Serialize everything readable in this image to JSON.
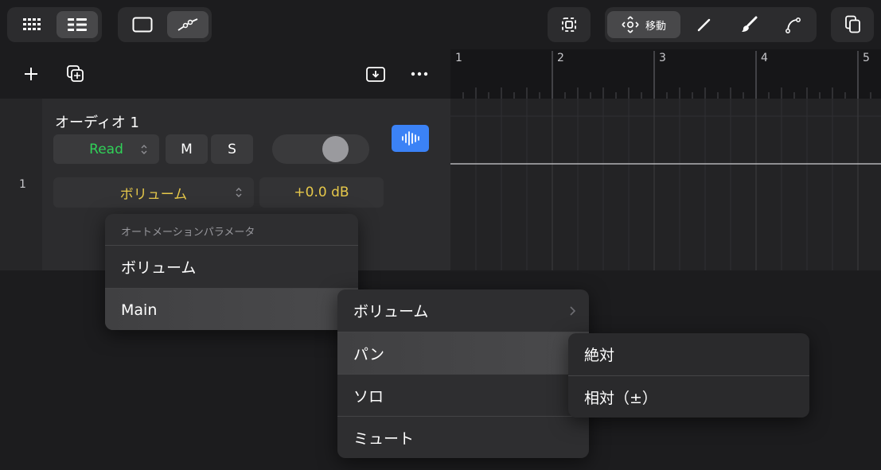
{
  "toolbar": {
    "move_label": "移動"
  },
  "ruler": {
    "bars": [
      "1",
      "2",
      "3",
      "4",
      "5"
    ]
  },
  "track": {
    "number": "1",
    "name": "オーディオ 1",
    "automation_mode": "Read",
    "mute_label": "M",
    "solo_label": "S",
    "param_selector": "ボリューム",
    "param_value": "+0.0 dB"
  },
  "menu_main": {
    "header": "オートメーションパラメータ",
    "items": [
      "ボリューム",
      "Main"
    ]
  },
  "menu_sub": {
    "items": [
      "ボリューム",
      "パン",
      "ソロ",
      "ミュート"
    ]
  },
  "menu_pan": {
    "items": [
      "絶対",
      "相対（±）"
    ]
  },
  "colors": {
    "read_green": "#30d158",
    "value_yellow": "#e6c84a",
    "accent_blue": "#3b82f6"
  }
}
